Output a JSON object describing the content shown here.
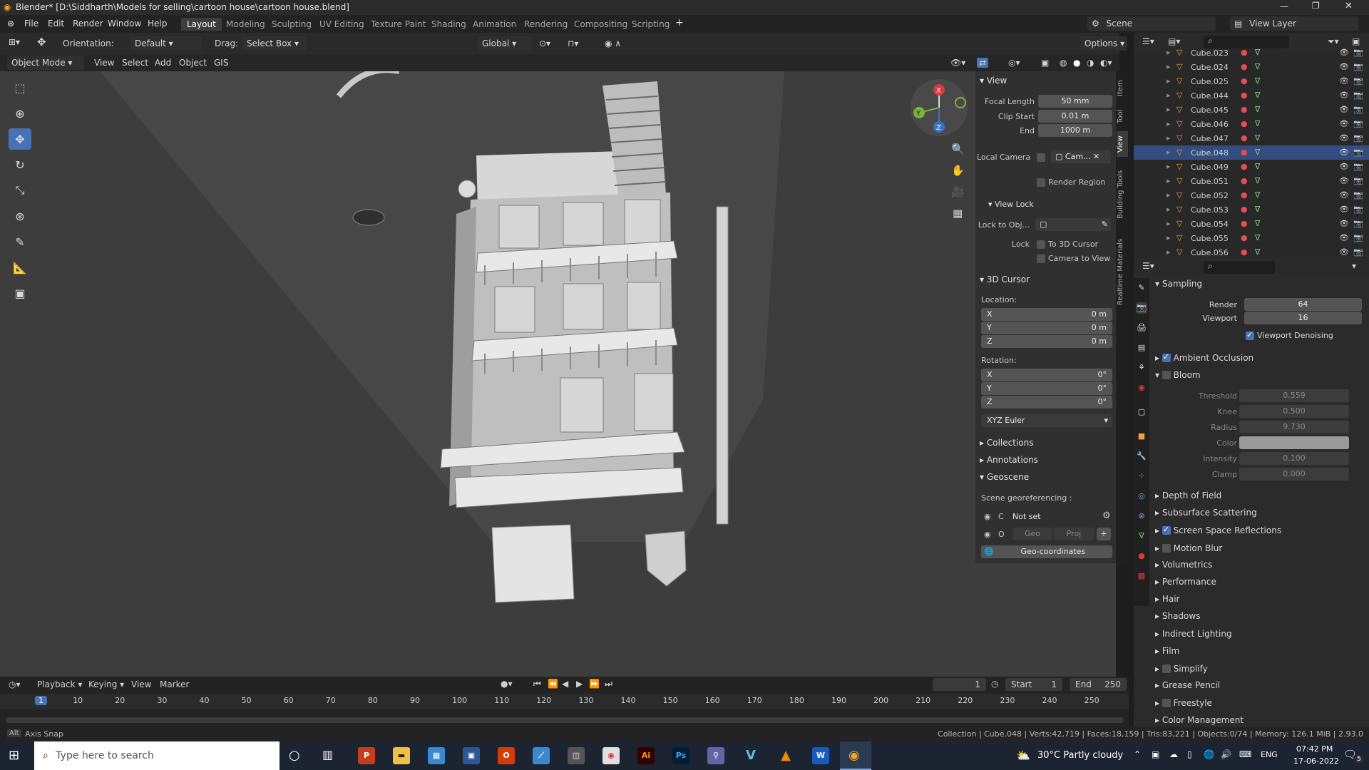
{
  "title": "Blender* [D:\\Siddharth\\Models for selling\\cartoon house\\cartoon house.blend]",
  "menu": [
    "File",
    "Edit",
    "Render",
    "Window",
    "Help"
  ],
  "workspaces": [
    "Layout",
    "Modeling",
    "Sculpting",
    "UV Editing",
    "Texture Paint",
    "Shading",
    "Animation",
    "Rendering",
    "Compositing",
    "Scripting"
  ],
  "scene_label": "Scene",
  "view_layer_label": "View Layer",
  "toolheader": {
    "orientation_label": "Orientation:",
    "orientation_value": "Default",
    "drag_label": "Drag:",
    "drag_value": "Select Box",
    "transform": "Global",
    "options": "Options"
  },
  "viewport_header": {
    "mode": "Object Mode",
    "items": [
      "View",
      "Select",
      "Add",
      "Object",
      "GIS"
    ]
  },
  "npanel": {
    "view_title": "View",
    "focal_label": "Focal Length",
    "focal_value": "50 mm",
    "clip_start_label": "Clip Start",
    "clip_start_value": "0.01 m",
    "end_label": "End",
    "end_value": "1000 m",
    "local_camera_label": "Local Camera",
    "local_camera_value": "Cam...",
    "render_region": "Render Region",
    "view_lock_title": "View Lock",
    "lock_to_obj_label": "Lock to Obj...",
    "lock_label": "Lock",
    "to_3d_cursor": "To 3D Cursor",
    "camera_to_view": "Camera to View",
    "cursor_title": "3D Cursor",
    "location_label": "Location:",
    "loc_x": "0 m",
    "loc_y": "0 m",
    "loc_z": "0 m",
    "rotation_label": "Rotation:",
    "rot_x": "0°",
    "rot_y": "0°",
    "rot_z": "0°",
    "euler": "XYZ Euler",
    "collections": "Collections",
    "annotations": "Annotations",
    "geoscene": "Geoscene",
    "scene_georef": "Scene georeferencing :",
    "c_label": "C",
    "not_set": "Not set",
    "o_label": "O",
    "geo": "Geo",
    "proj": "Proj",
    "geo_coords": "Geo-coordinates",
    "tabs": [
      "Item",
      "Tool",
      "View",
      "Building Tools",
      "Realtime Materials"
    ]
  },
  "outliner": {
    "rows": [
      "Cube.023",
      "Cube.024",
      "Cube.025",
      "Cube.044",
      "Cube.045",
      "Cube.046",
      "Cube.047",
      "Cube.048",
      "Cube.049",
      "Cube.051",
      "Cube.052",
      "Cube.053",
      "Cube.054",
      "Cube.055",
      "Cube.056"
    ],
    "selected": "Cube.048"
  },
  "props": {
    "sampling": "Sampling",
    "render_label": "Render",
    "render_value": "64",
    "viewport_label": "Viewport",
    "viewport_value": "16",
    "viewport_denoising": "Viewport Denoising",
    "ambient_occlusion": "Ambient Occlusion",
    "bloom": "Bloom",
    "threshold_label": "Threshold",
    "threshold_value": "0.559",
    "knee_label": "Knee",
    "knee_value": "0.500",
    "radius_label": "Radius",
    "radius_value": "9.730",
    "color_label": "Color",
    "intensity_label": "Intensity",
    "intensity_value": "0.100",
    "clamp_label": "Clamp",
    "clamp_value": "0.000",
    "sections": [
      "Depth of Field",
      "Subsurface Scattering",
      "Screen Space Reflections",
      "Motion Blur",
      "Volumetrics",
      "Performance",
      "Hair",
      "Shadows",
      "Indirect Lighting",
      "Film",
      "Simplify",
      "Grease Pencil",
      "Freestyle",
      "Color Management"
    ]
  },
  "timeline": {
    "items": [
      "Playback",
      "Keying",
      "View",
      "Marker"
    ],
    "current_frame": "1",
    "start_label": "Start",
    "start_value": "1",
    "end_label": "End",
    "end_value": "250",
    "ticks": [
      "1",
      "10",
      "20",
      "30",
      "40",
      "50",
      "60",
      "70",
      "80",
      "90",
      "100",
      "110",
      "120",
      "130",
      "140",
      "150",
      "160",
      "170",
      "180",
      "190",
      "200",
      "210",
      "220",
      "230",
      "240",
      "250"
    ]
  },
  "status": {
    "left": "Axis Snap",
    "right": "Collection | Cube.048 | Verts:42,719 | Faces:18,159 | Tris:83,221 | Objects:0/74 | Memory: 126.1 MiB | 2.93.0"
  },
  "taskbar": {
    "search": "Type here to search",
    "weather": "30°C  Partly cloudy",
    "lang": "ENG",
    "time": "07:42 PM",
    "date": "17-06-2022",
    "notif": "5"
  },
  "colors": {
    "accent": "#4772b3",
    "selected_row": "#334d80",
    "viewport_bg": "#3d3d3d"
  }
}
